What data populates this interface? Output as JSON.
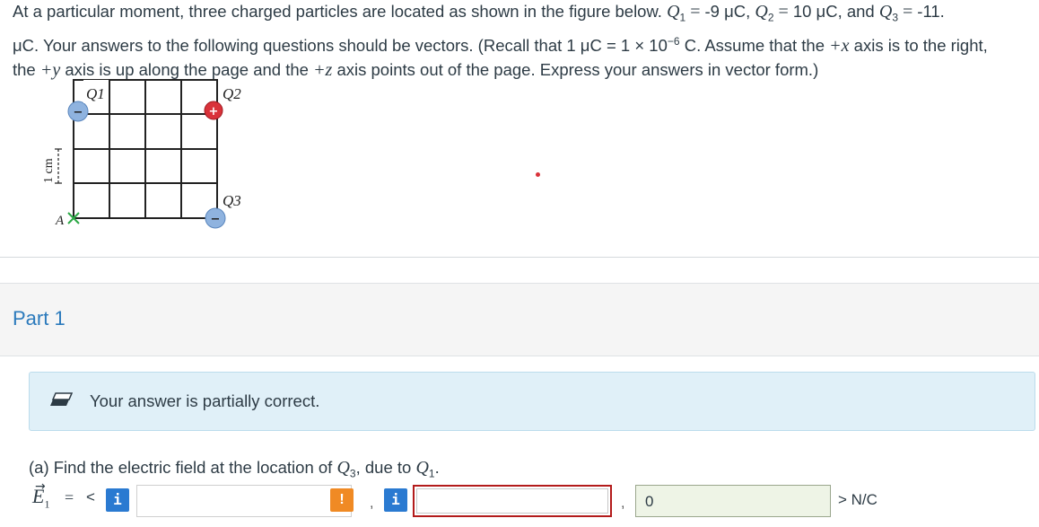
{
  "problem": {
    "line1_a": "At a particular moment, three charged particles are located as shown in the figure below. ",
    "q1_sym": "Q",
    "q1_sub": "1",
    "eq": " = ",
    "q1_val": " -9 μC, ",
    "q2_sym": "Q",
    "q2_sub": "2",
    "q2_val": " 10 μC, and ",
    "q3_sym": "Q",
    "q3_sub": "3",
    "q3_val": " -11.",
    "line2_a": "μC. Your answers to the following questions should be vectors. (Recall that 1 μC = 1 × 10",
    "exp": "−6",
    "line2_b": " C. Assume that the ",
    "plus_x": "+x",
    "line2_c": " axis is to the right,",
    "line3_a": "the ",
    "plus_y": "+y",
    "line3_b": " axis is up along the page and the ",
    "plus_z": "+z",
    "line3_c": " axis points out of the page. Express your answers in vector form.)"
  },
  "figure": {
    "label_q1": "Q1",
    "label_q2": "Q2",
    "label_q3": "Q3",
    "label_a": "A",
    "scale_label": "1 cm",
    "q1_sign": "−",
    "q2_sign": "+",
    "q3_sign": "−",
    "colors": {
      "negative": "#7ba7d9",
      "positive": "#d9323a",
      "marker": "#2aa845",
      "grid": "#222222"
    }
  },
  "part": {
    "title": "Part 1"
  },
  "feedback": {
    "text": "Your answer is partially correct.",
    "icon": "eraser-icon"
  },
  "question": {
    "prefix": "(a) Find the electric field at the location of ",
    "q3_sym": "Q",
    "q3_sub": "3",
    "mid": ", due to ",
    "q1_sym": "Q",
    "q1_sub": "1",
    "suffix": "."
  },
  "answer": {
    "vector_label": "E",
    "vector_sub": "1",
    "equals": "=",
    "open": "<",
    "info_symbol": "i",
    "warn_symbol": "!",
    "x_value": "",
    "y_value": "",
    "z_value": "0",
    "comma": ",",
    "close_unit": "> N/C"
  },
  "colors": {
    "accent": "#2b7abc",
    "info": "#2a7ad1",
    "warning": "#f08a24",
    "error": "#b31b1b"
  }
}
